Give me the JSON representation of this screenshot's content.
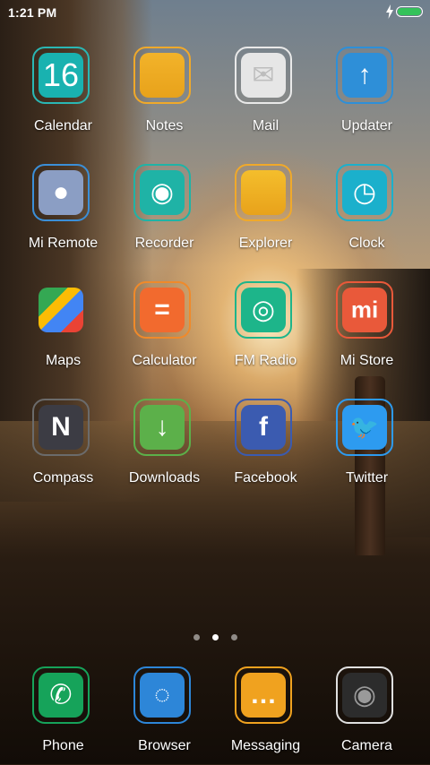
{
  "status_bar": {
    "time": "1:21 PM",
    "battery_level": 1.0,
    "charging": true,
    "battery_color": "#34c25a"
  },
  "apps": [
    {
      "id": "calendar",
      "label": "Calendar",
      "icon": "calendar-icon",
      "glyph": "16",
      "color": "#19b2b0",
      "border": "#2ab7b4"
    },
    {
      "id": "notes",
      "label": "Notes",
      "icon": "notes-icon",
      "glyph": "",
      "color": "#f2b32a",
      "border": "#f0a92a"
    },
    {
      "id": "mail",
      "label": "Mail",
      "icon": "mail-icon",
      "glyph": "✉",
      "color": "#e6e6e6",
      "border": "#e9e9e9"
    },
    {
      "id": "updater",
      "label": "Updater",
      "icon": "arrow-up-icon",
      "glyph": "↑",
      "color": "#2e8fd8",
      "border": "#2e8fd8"
    },
    {
      "id": "mi_remote",
      "label": "Mi Remote",
      "icon": "remote-icon",
      "glyph": "●",
      "color": "#8b9ec4",
      "border": "#3b8fd8"
    },
    {
      "id": "recorder",
      "label": "Recorder",
      "icon": "record-icon",
      "glyph": "◉",
      "color": "#1fb3a6",
      "border": "#1fb3a6"
    },
    {
      "id": "explorer",
      "label": "Explorer",
      "icon": "folder-icon",
      "glyph": "",
      "color": "#f4be2c",
      "border": "#f0a92a"
    },
    {
      "id": "clock",
      "label": "Clock",
      "icon": "clock-icon",
      "glyph": "◷",
      "color": "#1bb0cc",
      "border": "#1bb0cc"
    },
    {
      "id": "maps",
      "label": "Maps",
      "icon": "maps-icon",
      "glyph": "",
      "color": "#ffffff",
      "border": "rgba(0,0,0,0)"
    },
    {
      "id": "calculator",
      "label": "Calculator",
      "icon": "calculator-icon",
      "glyph": "=",
      "color": "#f26a2e",
      "border": "#f08a2a"
    },
    {
      "id": "fm_radio",
      "label": "FM Radio",
      "icon": "radio-icon",
      "glyph": "◎",
      "color": "#1db58a",
      "border": "#1db58a"
    },
    {
      "id": "mi_store",
      "label": "Mi Store",
      "icon": "mi-store-icon",
      "glyph": "mi",
      "color": "#e9593a",
      "border": "#e9593a"
    },
    {
      "id": "compass",
      "label": "Compass",
      "icon": "compass-icon",
      "glyph": "N",
      "color": "#3c3c44",
      "border": "#6b6b6b"
    },
    {
      "id": "downloads",
      "label": "Downloads",
      "icon": "download-icon",
      "glyph": "↓",
      "color": "#5cb04a",
      "border": "#5cb04a"
    },
    {
      "id": "facebook",
      "label": "Facebook",
      "icon": "facebook-icon",
      "glyph": "f",
      "color": "#3b5bb0",
      "border": "#3b5bb0"
    },
    {
      "id": "twitter",
      "label": "Twitter",
      "icon": "twitter-icon",
      "glyph": "🐦",
      "color": "#2d9bf0",
      "border": "#2d9bf0"
    }
  ],
  "page_indicator": {
    "count": 3,
    "active": 1
  },
  "dock": [
    {
      "id": "phone",
      "label": "Phone",
      "icon": "phone-icon",
      "glyph": "✆",
      "color": "#16a35a",
      "border": "#16a35a"
    },
    {
      "id": "browser",
      "label": "Browser",
      "icon": "browser-icon",
      "glyph": "◌",
      "color": "#2d86d8",
      "border": "#2d86d8"
    },
    {
      "id": "messaging",
      "label": "Messaging",
      "icon": "message-icon",
      "glyph": "…",
      "color": "#f0a21f",
      "border": "#f0a21f"
    },
    {
      "id": "camera",
      "label": "Camera",
      "icon": "camera-icon",
      "glyph": "◉",
      "color": "#2c2c2c",
      "border": "#e0e0e0"
    }
  ]
}
